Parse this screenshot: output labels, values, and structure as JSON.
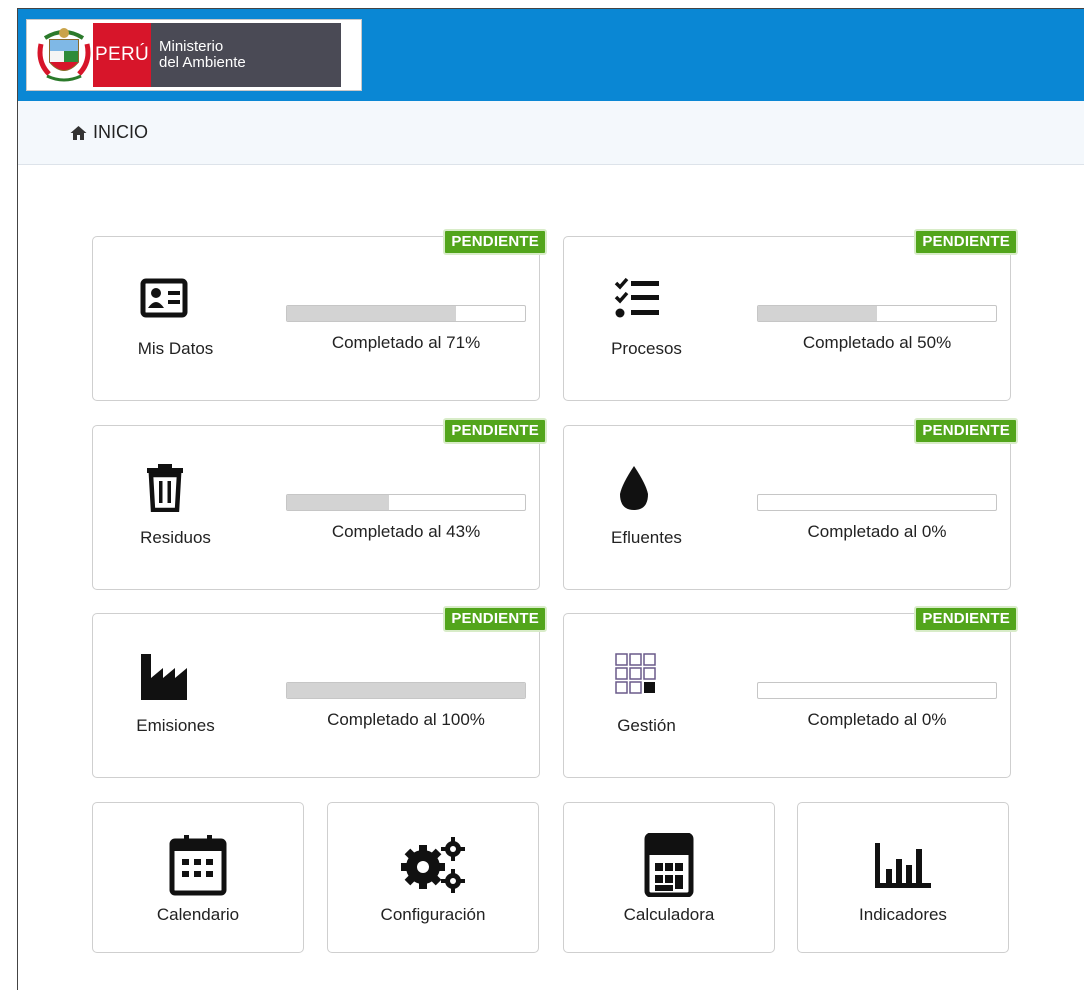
{
  "header": {
    "logo": {
      "country": "PERÚ",
      "ministry_line1": "Ministerio",
      "ministry_line2": "del Ambiente",
      "shield_icon": "peru-coat-of-arms-icon"
    },
    "brand_color": "#0a87d4"
  },
  "breadcrumb": {
    "label": "INICIO",
    "icon": "home-icon"
  },
  "modules": [
    {
      "label": "Mis Datos",
      "status": "PENDIENTE",
      "progress_text": "Completado al 71%",
      "progress": 71,
      "icon": "id-card-icon"
    },
    {
      "label": "Procesos",
      "status": "PENDIENTE",
      "progress_text": "Completado al 50%",
      "progress": 50,
      "icon": "checklist-icon"
    },
    {
      "label": "Residuos",
      "status": "PENDIENTE",
      "progress_text": "Completado al 43%",
      "progress": 43,
      "icon": "trash-icon"
    },
    {
      "label": "Efluentes",
      "status": "PENDIENTE",
      "progress_text": "Completado al 0%",
      "progress": 0,
      "icon": "drop-icon"
    },
    {
      "label": "Emisiones",
      "status": "PENDIENTE",
      "progress_text": "Completado al 100%",
      "progress": 100,
      "icon": "factory-icon"
    },
    {
      "label": "Gestión",
      "status": "PENDIENTE",
      "progress_text": "Completado al 0%",
      "progress": 0,
      "icon": "grid-icon"
    }
  ],
  "tools": [
    {
      "label": "Calendario",
      "icon": "calendar-icon"
    },
    {
      "label": "Configuración",
      "icon": "gears-icon"
    },
    {
      "label": "Calculadora",
      "icon": "calculator-icon"
    },
    {
      "label": "Indicadores",
      "icon": "bar-chart-icon"
    }
  ],
  "colors": {
    "badge": "#52a51b",
    "progress_fill": "#d3d3d3",
    "peru_red": "#d7152a"
  }
}
